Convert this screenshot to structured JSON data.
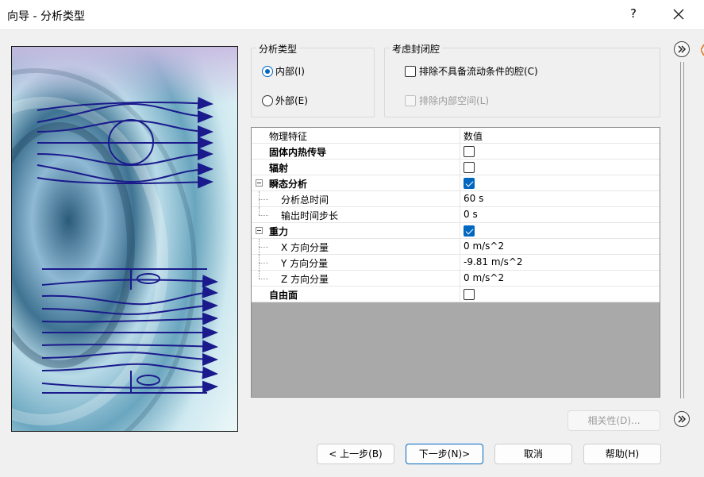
{
  "window": {
    "title": "向导 - 分析类型",
    "help_label": "?"
  },
  "analysis_type": {
    "title": "分析类型",
    "internal_label": "内部(I)",
    "external_label": "外部(E)",
    "selected": "internal"
  },
  "enclosed_cavity": {
    "title": "考虑封闭腔",
    "exclude_no_flow_label": "排除不具备流动条件的腔(C)",
    "exclude_no_flow_checked": false,
    "exclude_internal_space_label": "排除内部空间(L)",
    "exclude_internal_space_checked": false,
    "exclude_internal_space_enabled": false
  },
  "property_grid": {
    "header": {
      "name": "物理特征",
      "value": "数值"
    },
    "rows": [
      {
        "name": "固体内热传导",
        "bold": true,
        "level": 0,
        "type": "checkbox",
        "checked": false
      },
      {
        "name": "辐射",
        "bold": true,
        "level": 0,
        "type": "checkbox",
        "checked": false
      },
      {
        "name": "瞬态分析",
        "bold": true,
        "level": 0,
        "type": "checkbox",
        "checked": true,
        "expandable": true
      },
      {
        "name": "分析总时间",
        "level": 1,
        "type": "text",
        "value": "60 s"
      },
      {
        "name": "输出时间步长",
        "level": 1,
        "type": "text",
        "value": "0 s",
        "last_child": true
      },
      {
        "name": "重力",
        "bold": true,
        "level": 0,
        "type": "checkbox",
        "checked": true,
        "expandable": true
      },
      {
        "name": "X 方向分量",
        "level": 1,
        "type": "text",
        "value": "0 m/s^2"
      },
      {
        "name": "Y 方向分量",
        "level": 1,
        "type": "text",
        "value": "-9.81 m/s^2"
      },
      {
        "name": "Z 方向分量",
        "level": 1,
        "type": "text",
        "value": "0 m/s^2",
        "last_child": true
      },
      {
        "name": "自由面",
        "bold": true,
        "level": 0,
        "type": "checkbox",
        "checked": false
      }
    ]
  },
  "buttons": {
    "dependency": "相关性(D)...",
    "back": "< 上一步(B)",
    "next": "下一步(N)>",
    "cancel": "取消",
    "help": "帮助(H)"
  },
  "colors": {
    "accent": "#0067c0",
    "illustration_arrow": "#1a1a8c",
    "grid_empty": "#a9a9a9",
    "orange_mark": "#e36b1a"
  },
  "icons": {
    "close": "close-icon",
    "scroll_up": "double-chevron-right-icon",
    "scroll_down": "double-chevron-right-icon"
  }
}
